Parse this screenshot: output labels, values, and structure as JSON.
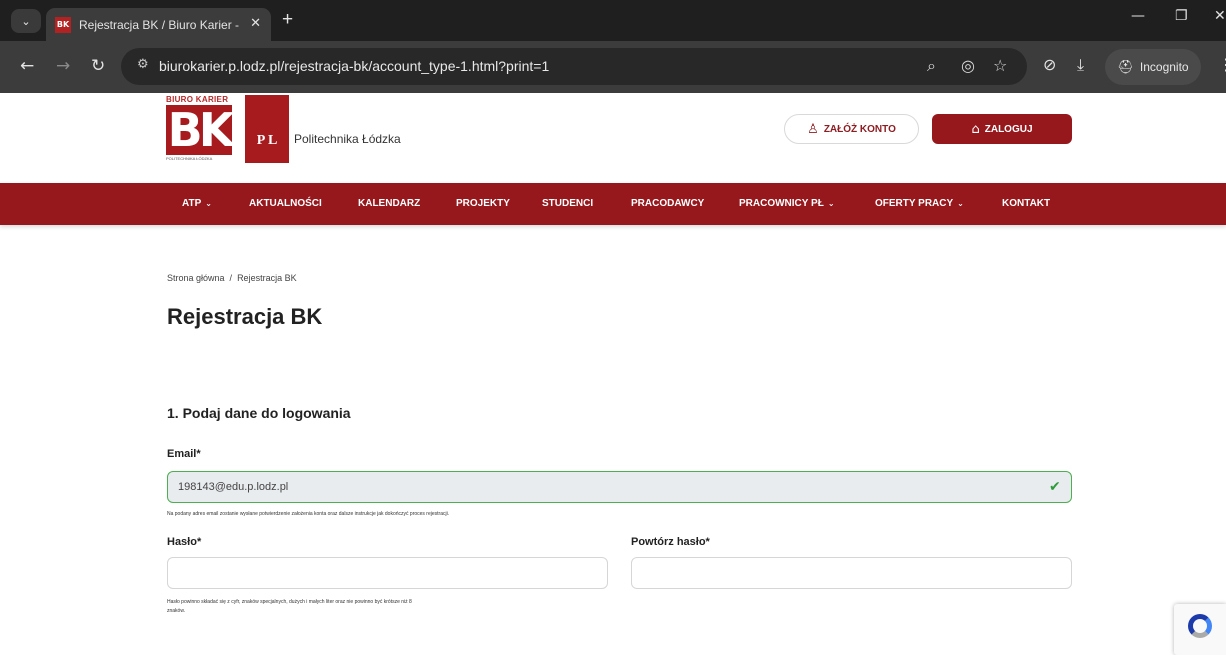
{
  "browser": {
    "tab_title": "Rejestracja BK / Biuro Karier - P",
    "tab_favicon": "BK",
    "url": "biurokarier.p.lodz.pl/rejestracja-bk/account_type-1.html?print=1",
    "incognito_label": "Incognito"
  },
  "header": {
    "logo_bk_top": "BIURO KARIER",
    "logo_bk_letters": "BK",
    "logo_bk_bottom": "POLITECHNIKA ŁÓDZKA",
    "logo_pl_letters": "P L",
    "university_name": "Politechnika Łódzka",
    "register_label": "ZAŁÓŻ KONTO",
    "login_label": "ZALOGUJ",
    "accent_color": "#96171c"
  },
  "nav": {
    "items": [
      {
        "label": "ATP",
        "dropdown": true
      },
      {
        "label": "AKTUALNOŚCI",
        "dropdown": false
      },
      {
        "label": "KALENDARZ",
        "dropdown": false
      },
      {
        "label": "PROJEKTY",
        "dropdown": false
      },
      {
        "label": "STUDENCI",
        "dropdown": false
      },
      {
        "label": "PRACODAWCY",
        "dropdown": false
      },
      {
        "label": "PRACOWNICY PŁ",
        "dropdown": true
      },
      {
        "label": "OFERTY PRACY",
        "dropdown": true
      },
      {
        "label": "KONTAKT",
        "dropdown": false
      }
    ]
  },
  "breadcrumb": {
    "home": "Strona główna",
    "separator": "/",
    "current": "Rejestracja BK"
  },
  "page": {
    "title": "Rejestracja BK",
    "section_title": "1. Podaj dane do logowania"
  },
  "form": {
    "email_label": "Email*",
    "email_value": "198143@edu.p.lodz.pl",
    "email_hint": "Na podany adres email zostanie wysłane potwierdzenie założenia konta oraz dalsze instrukcje jak dokończyć proces rejestracji.",
    "password_label": "Hasło*",
    "password_value": "",
    "password_repeat_label": "Powtórz hasło*",
    "password_repeat_value": "",
    "password_hint_line1": "Hasło powinno składać się z cyfr, znaków specjalnych, dużych i małych liter oraz nie powinno być krótsze niż 8",
    "password_hint_line2": "znaków."
  }
}
